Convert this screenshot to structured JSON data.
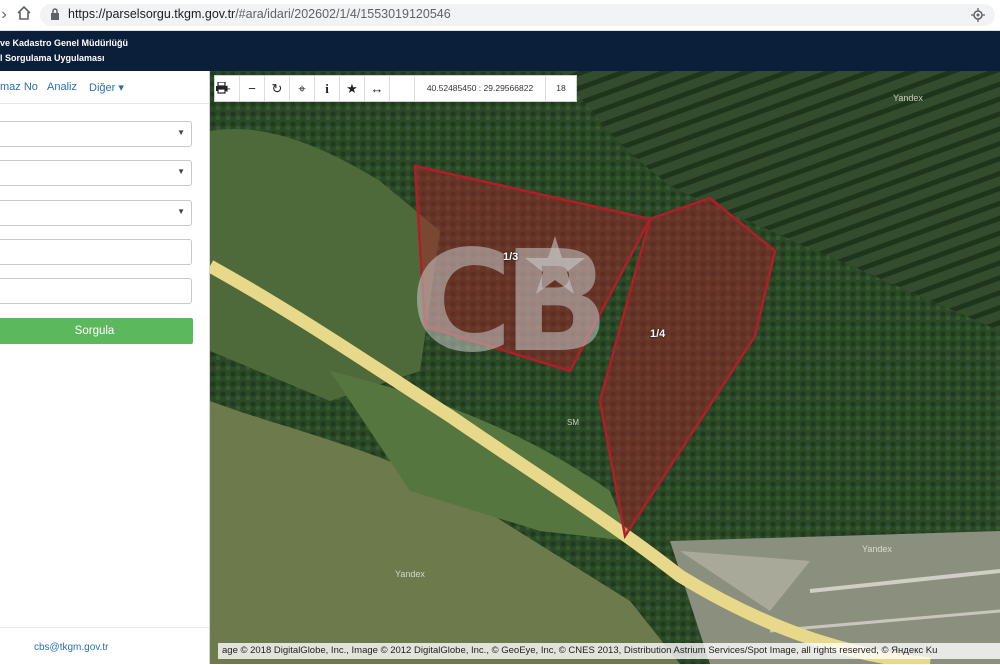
{
  "browser": {
    "url_prefix": "https://parselsorgu.tkgm.gov.tr",
    "url_rest": "/#ara/idari/202602/1/4/1553019120546"
  },
  "header": {
    "line1": "ve Kadastro Genel Müdürlüğü",
    "line2": "l Sorgulama Uygulaması"
  },
  "sidebar": {
    "nav": [
      "maz No",
      "Analiz",
      "Diğer ▾"
    ],
    "submit_label": "Sorgula",
    "footer_email": "cbs@tkgm.gov.tr"
  },
  "map": {
    "toolbar": {
      "coordinates": "40.52485450 : 29.29566822",
      "zoom": "18"
    },
    "parcels": [
      "1/3",
      "1/4"
    ],
    "parcel_color": "#b01e2a",
    "yandex_labels": [
      "Yandex",
      "Yandex",
      "Yandex"
    ],
    "road_label": "SM",
    "attribution": "age © 2018 DigitalGlobe, Inc., Image © 2012 DigitalGlobe, Inc., © GeoEye, Inc, © CNES 2013, Distribution Astrium Services/Spot Image, all rights reserved, © Яндекс Ku",
    "watermark": "CB"
  },
  "colors": {
    "header_bg": "#0c1f3a",
    "button_green": "#5cb85c",
    "link_blue": "#2a6fb3"
  }
}
